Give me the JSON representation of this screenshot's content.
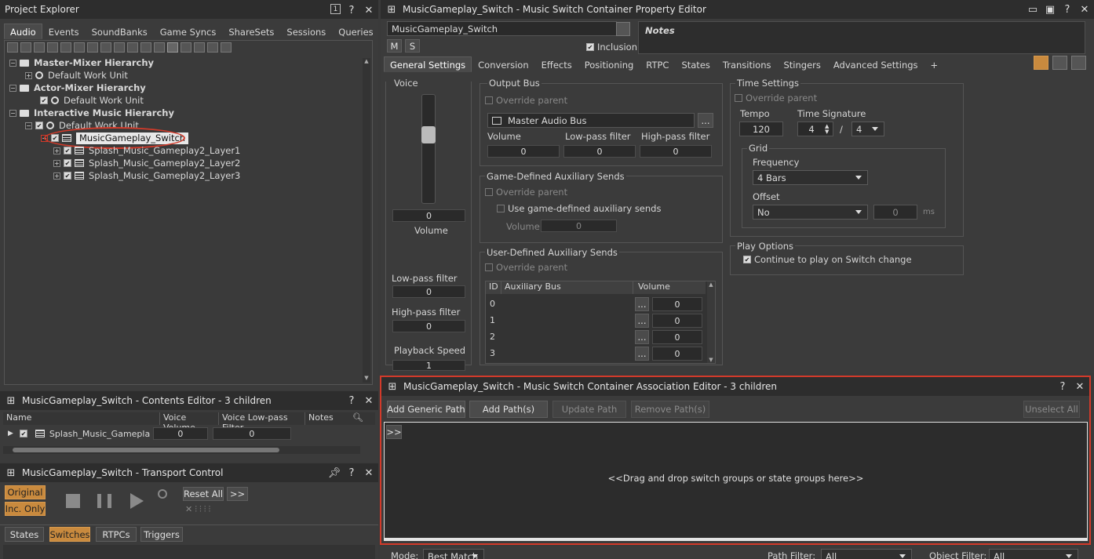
{
  "project_explorer": {
    "title": "Project Explorer",
    "tabs": [
      "Audio",
      "Events",
      "SoundBanks",
      "Game Syncs",
      "ShareSets",
      "Sessions",
      "Queries"
    ],
    "tree": {
      "master_mixer": "Master-Mixer Hierarchy",
      "master_wu": "Default Work Unit",
      "actor_mixer": "Actor-Mixer Hierarchy",
      "actor_wu": "Default Work Unit",
      "interactive": "Interactive Music Hierarchy",
      "interactive_wu": "Default Work Unit",
      "switch": "MusicGameplay_Switch",
      "layers": [
        "Splash_Music_Gameplay2_Layer1",
        "Splash_Music_Gameplay2_Layer2",
        "Splash_Music_Gameplay2_Layer3"
      ]
    }
  },
  "contents_editor": {
    "title": "MusicGameplay_Switch - Contents Editor - 3 children",
    "columns": [
      "Name",
      "Voice Volume",
      "Voice Low-pass Filter",
      "Notes"
    ],
    "row": {
      "name": "Splash_Music_Gameplay...",
      "volume": "0",
      "lpf": "0"
    }
  },
  "transport": {
    "title": "MusicGameplay_Switch - Transport Control",
    "original": "Original",
    "inc_only": "Inc. Only",
    "reset_all": "Reset All",
    "more": ">>",
    "tabs": [
      "States",
      "Switches",
      "RTPCs",
      "Triggers"
    ]
  },
  "property_editor": {
    "title": "MusicGameplay_Switch - Music Switch Container Property Editor",
    "name_value": "MusicGameplay_Switch",
    "m": "M",
    "s": "S",
    "inclusion": "Inclusion",
    "notes": "Notes",
    "tabs": [
      "General Settings",
      "Conversion",
      "Effects",
      "Positioning",
      "RTPC",
      "States",
      "Transitions",
      "Stingers",
      "Advanced Settings",
      "+"
    ],
    "voice": {
      "label": "Voice",
      "value": "0",
      "volume_label": "Volume",
      "lpf_label": "Low-pass filter",
      "lpf": "0",
      "hpf_label": "High-pass filter",
      "hpf": "0",
      "playback_speed": "Playback Speed",
      "playback_value": "1"
    },
    "output_bus": {
      "label": "Output Bus",
      "override": "Override parent",
      "bus": "Master Audio Bus",
      "browse": "...",
      "volume": "Volume",
      "lpf": "Low-pass filter",
      "hpf": "High-pass filter",
      "vol_val": "0",
      "lpf_val": "0",
      "hpf_val": "0"
    },
    "game_aux": {
      "label": "Game-Defined Auxiliary Sends",
      "override": "Override parent",
      "use": "Use game-defined auxiliary sends",
      "volume": "Volume",
      "value": "0"
    },
    "user_aux": {
      "label": "User-Defined Auxiliary Sends",
      "override": "Override parent",
      "columns": [
        "ID",
        "Auxiliary Bus",
        "Volume"
      ],
      "rows": [
        {
          "id": "0",
          "vol": "0"
        },
        {
          "id": "1",
          "vol": "0"
        },
        {
          "id": "2",
          "vol": "0"
        },
        {
          "id": "3",
          "vol": "0"
        }
      ],
      "browse": "..."
    },
    "time": {
      "label": "Time Settings",
      "override": "Override parent",
      "tempo_label": "Tempo",
      "tempo": "120",
      "sig_label": "Time Signature",
      "sig_num": "4",
      "slash": "/",
      "sig_den": "4"
    },
    "grid": {
      "label": "Grid",
      "freq_label": "Frequency",
      "freq": "4 Bars",
      "offset_label": "Offset",
      "offset": "No",
      "offset_val": "0",
      "ms": "ms"
    },
    "play_options": {
      "label": "Play Options",
      "continue": "Continue to play on Switch change"
    }
  },
  "association_editor": {
    "title": "MusicGameplay_Switch - Music Switch Container Association Editor - 3 children",
    "add_generic": "Add Generic Path",
    "add_paths": "Add Path(s)",
    "update": "Update Path",
    "remove": "Remove Path(s)",
    "unselect": "Unselect All",
    "expand": ">>",
    "drop_hint": "<<Drag and drop switch groups or state groups here>>",
    "mode_label": "Mode:",
    "mode": "Best Match",
    "path_filter_label": "Path Filter:",
    "path_filter": "All",
    "object_filter_label": "Object Filter:",
    "object_filter": "All"
  },
  "colors": {
    "highlight_red": "#d23a2a",
    "accent_orange": "#c98a3e",
    "selection": "#e8e8e8"
  }
}
